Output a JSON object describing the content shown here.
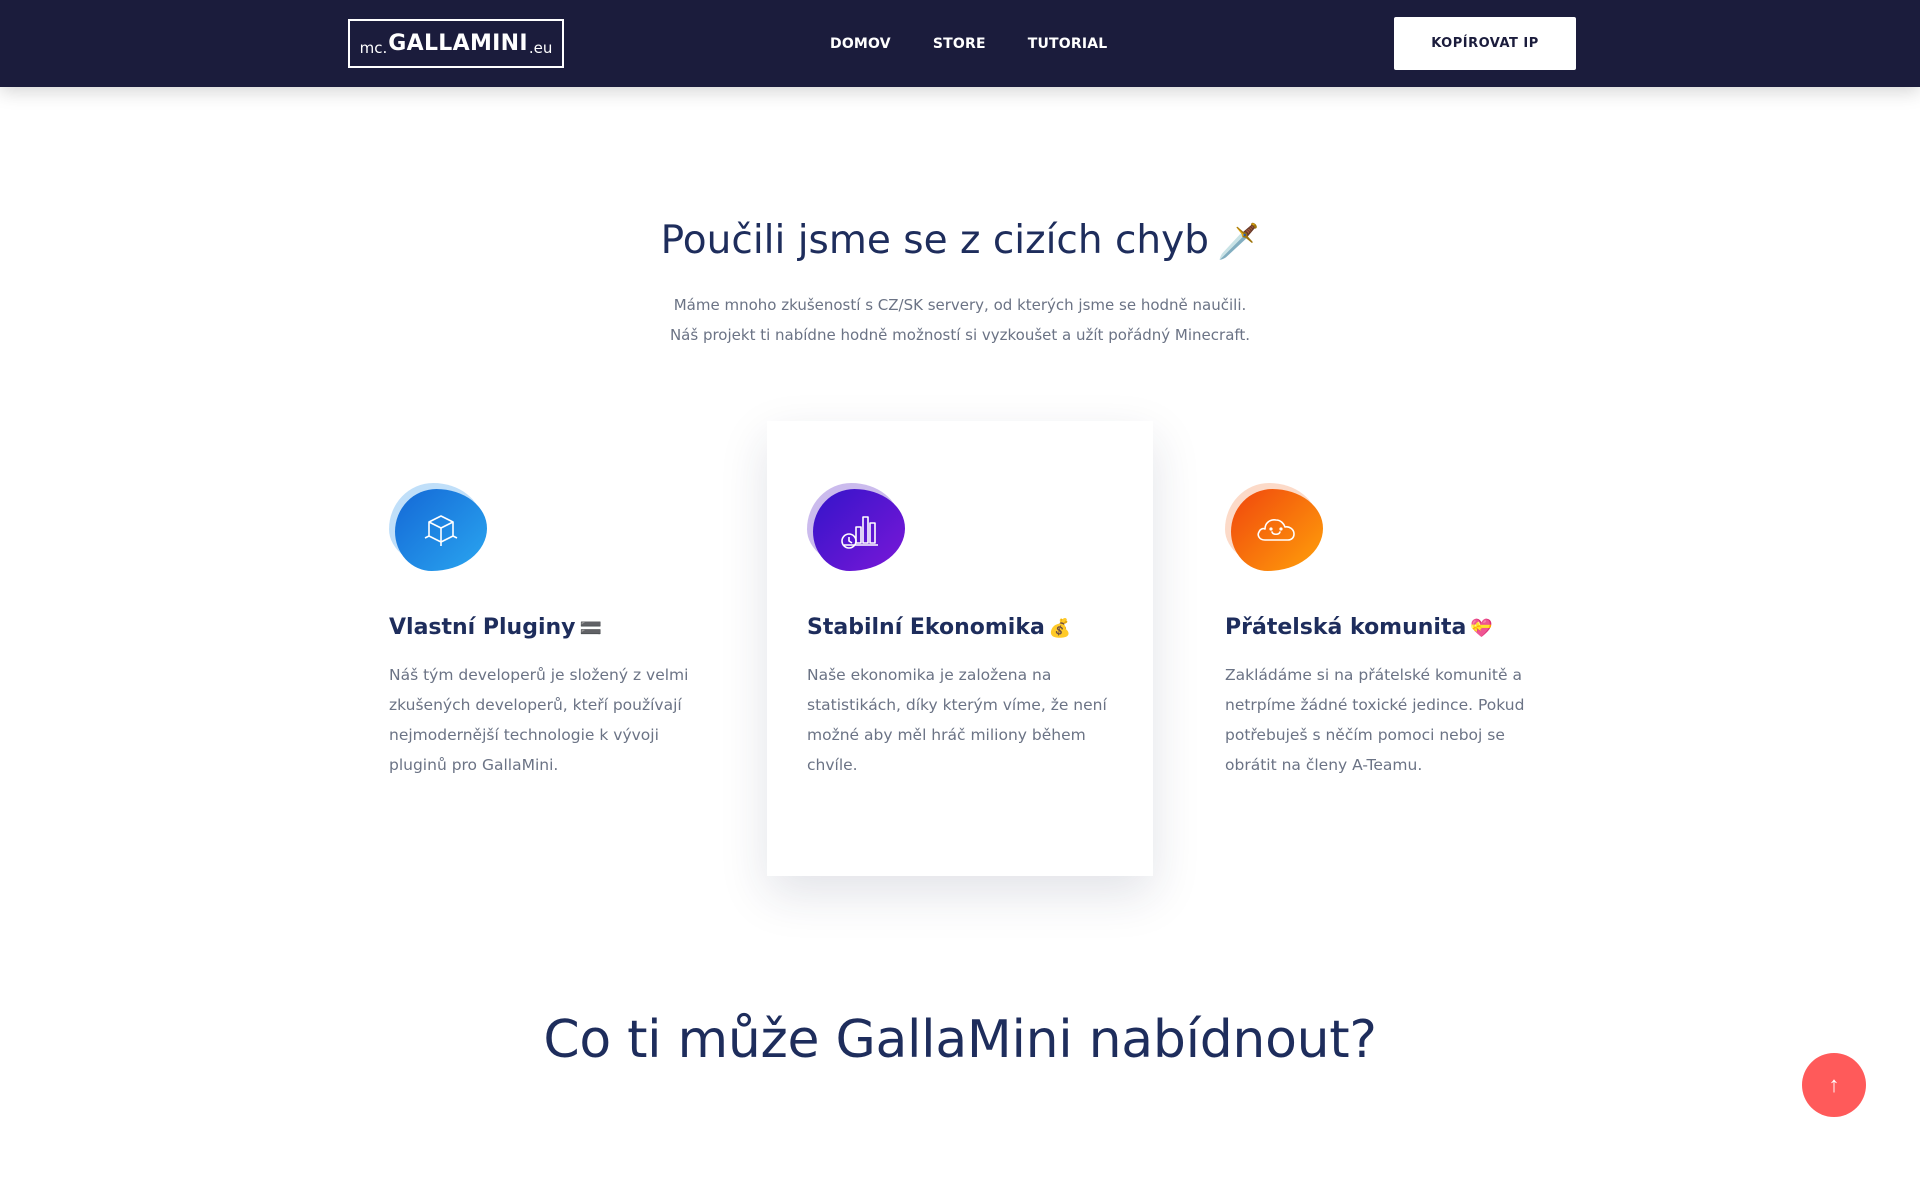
{
  "header": {
    "logo": {
      "prefix": "mc.",
      "main": "GALLAMINI",
      "suffix": ".eu"
    },
    "nav": [
      "DOMOV",
      "STORE",
      "TUTORIAL"
    ],
    "copy_ip_label": "KOPÍROVAT IP"
  },
  "intro": {
    "title": "Poučili jsme se z cizích chyb",
    "title_emoji": "🗡️",
    "lines": [
      "Máme mnoho zkušeností s CZ/SK servery, od kterých jsme se hodně naučili.",
      "Náš projekt ti nabídne hodně možností si vyzkoušet a užít pořádný Minecraft."
    ]
  },
  "features": [
    {
      "icon": "cube-icon",
      "title": "Vlastní Pluginy",
      "emoji": "🟰",
      "text": "Náš tým developerů je složený z velmi zkušených developerů, kteří používají nejmodernější technologie k vývoji pluginů pro GallaMini."
    },
    {
      "icon": "chart-icon",
      "title": "Stabilní Ekonomika",
      "emoji": "💰",
      "text": "Naše ekonomika je založena na statistikách, díky kterým víme, že není možné aby měl hráč miliony během chvíle."
    },
    {
      "icon": "cloud-icon",
      "title": "Přátelská komunita",
      "emoji": "💝",
      "text": "Zakládáme si na přátelské komunitě a netrpíme žádné toxické jedince. Pokud potřebuješ s něčím pomoci neboj se obrátit na členy A-Teamu."
    }
  ],
  "bottom": {
    "title": "Co ti může GallaMini nabídnout?"
  },
  "scroll_top": {
    "icon": "arrow-up-icon",
    "glyph": "↑"
  },
  "colors": {
    "navbar": "#1b1c3c",
    "heading": "#1e2d5c",
    "body_text": "#6b7385",
    "accent_button": "#ff5a5a"
  }
}
